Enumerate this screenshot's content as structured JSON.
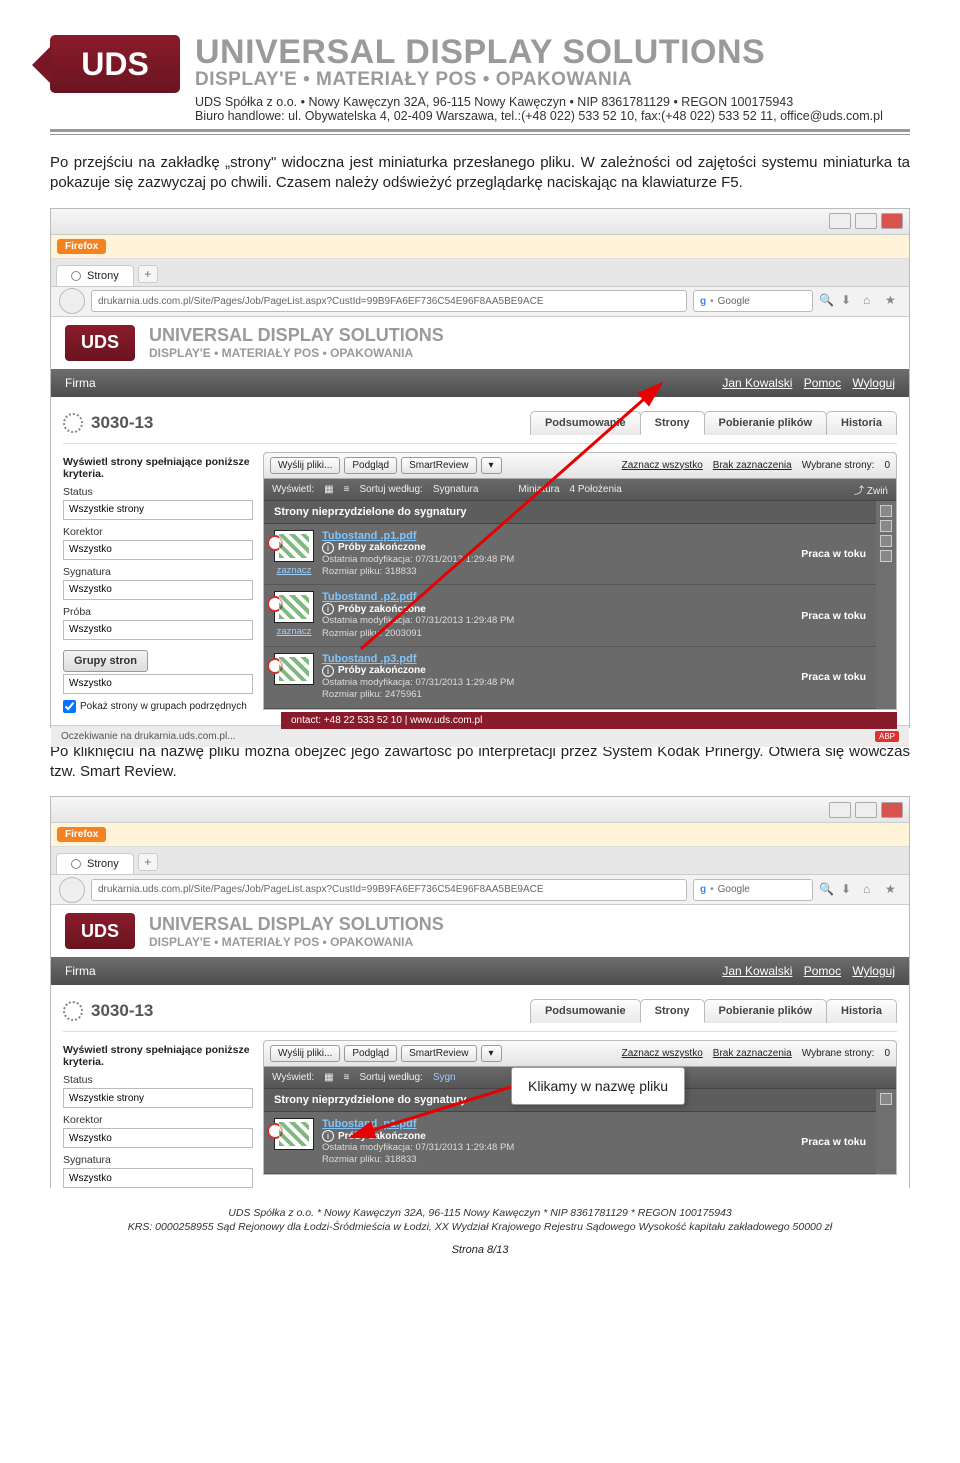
{
  "letterhead": {
    "logo": "UDS",
    "title": "UNIVERSAL DISPLAY SOLUTIONS",
    "subtitle": "DISPLAY'E • MATERIAŁY POS • OPAKOWANIA",
    "line1": "UDS Spółka z o.o. • Nowy Kawęczyn 32A, 96-115 Nowy Kawęczyn • NIP 8361781129 • REGON 100175943",
    "line2": "Biuro handlowe: ul. Obywatelska 4, 02-409 Warszawa, tel.:(+48 022) 533 52 10, fax:(+48 022) 533 52 11, office@uds.com.pl"
  },
  "para1": "Po przejściu na zakładkę „strony\" widoczna jest miniaturka przesłanego pliku. W zależności od zajętości systemu miniaturka ta pokazuje się zazwyczaj po chwili. Czasem należy odświeżyć przeglądarkę naciskając na klawiaturze F5.",
  "para2": "Po kliknięciu na nazwę pliku można obejżeć jego zawartość po interpretacji przez System Kodak Prinergy. Otwiera się wówczas tzw. Smart Review.",
  "browser": {
    "firefox": "Firefox",
    "tab_title": "Strony",
    "url": "drukarnia.uds.com.pl/Site/Pages/Job/PageList.aspx?CustId=99B9FA6EF736C54E96F8AA5BE9ACE",
    "google": "Google"
  },
  "app": {
    "brand_big": "UNIVERSAL DISPLAY SOLUTIONS",
    "brand_sub": "DISPLAY'E • MATERIAŁY POS • OPAKOWANIA",
    "firma": "Firma",
    "user": "Jan Kowalski",
    "pomoc": "Pomoc",
    "wyloguj": "Wyloguj",
    "job": "3030-13",
    "tabs": {
      "podsumowanie": "Podsumowanie",
      "strony": "Strony",
      "pobieranie": "Pobieranie plików",
      "historia": "Historia"
    },
    "left": {
      "hdr": "Wyświetl strony spełniające poniższe kryteria.",
      "status": "Status",
      "status_v": "Wszystkie strony",
      "korektor": "Korektor",
      "korektor_v": "Wszystko",
      "sygnatura": "Sygnatura",
      "sygnatura_v": "Wszystko",
      "proba": "Próba",
      "proba_v": "Wszystko",
      "grupy": "Grupy stron",
      "wszystko2": "Wszystko",
      "pokaz": "Pokaż strony w grupach podrzędnych"
    },
    "toolbar": {
      "wyslij": "Wyślij pliki...",
      "podglad": "Podgląd",
      "smart": "SmartReview",
      "zaznacz": "Zaznacz wszystko",
      "brak": "Brak zaznaczenia",
      "wybrane": "Wybrane strony:",
      "wybrane_n": "0",
      "wyswietl": "Wyświetl:",
      "sortuj": "Sortuj według:",
      "sortuj_v": "Sygnatura",
      "miniatura": "Miniatura",
      "polozenia": "4 Położenia",
      "zwin": "Zwiń"
    },
    "section_hdr": "Strony nieprzydzielone do sygnatury",
    "rows": [
      {
        "file": "Tubostand .p1.pdf",
        "proby": "Próby zakończone",
        "mod": "Ostatnia modyfikacja: 07/31/2013 1:29:48 PM",
        "size": "Rozmiar pliku: 318833",
        "status": "Praca w toku",
        "zaznacz": "zaznacz"
      },
      {
        "file": "Tubostand .p2.pdf",
        "proby": "Próby zakończone",
        "mod": "Ostatnia modyfikacja: 07/31/2013 1:29:48 PM",
        "size": "Rozmiar pliku: 2003091",
        "status": "Praca w toku",
        "zaznacz": "zaznacz"
      },
      {
        "file": "Tubostand .p3.pdf",
        "proby": "Próby zakończone",
        "mod": "Ostatnia modyfikacja: 07/31/2013 1:29:48 PM",
        "size": "Rozmiar pliku: 2475961",
        "status": "Praca w toku",
        "zaznacz": ""
      }
    ],
    "statusbar": "Oczekiwanie na drukarnia.uds.com.pl...",
    "contact": "ontact: +48 22 533 52 10  |  www.uds.com.pl"
  },
  "callout": "Klikamy w nazwę pliku",
  "footer": {
    "l1": "UDS Spółka z o.o. * Nowy Kawęczyn 32A, 96-115 Nowy Kawęczyn * NIP 8361781129 * REGON 100175943",
    "l2": "KRS: 0000258955 Sąd Rejonowy dla Łodzi-Śródmieścia w Łodzi, XX Wydział Krajowego Rejestru Sądowego Wysokość kapitału zakładowego 50000 zł",
    "page": "Strona 8/13"
  }
}
